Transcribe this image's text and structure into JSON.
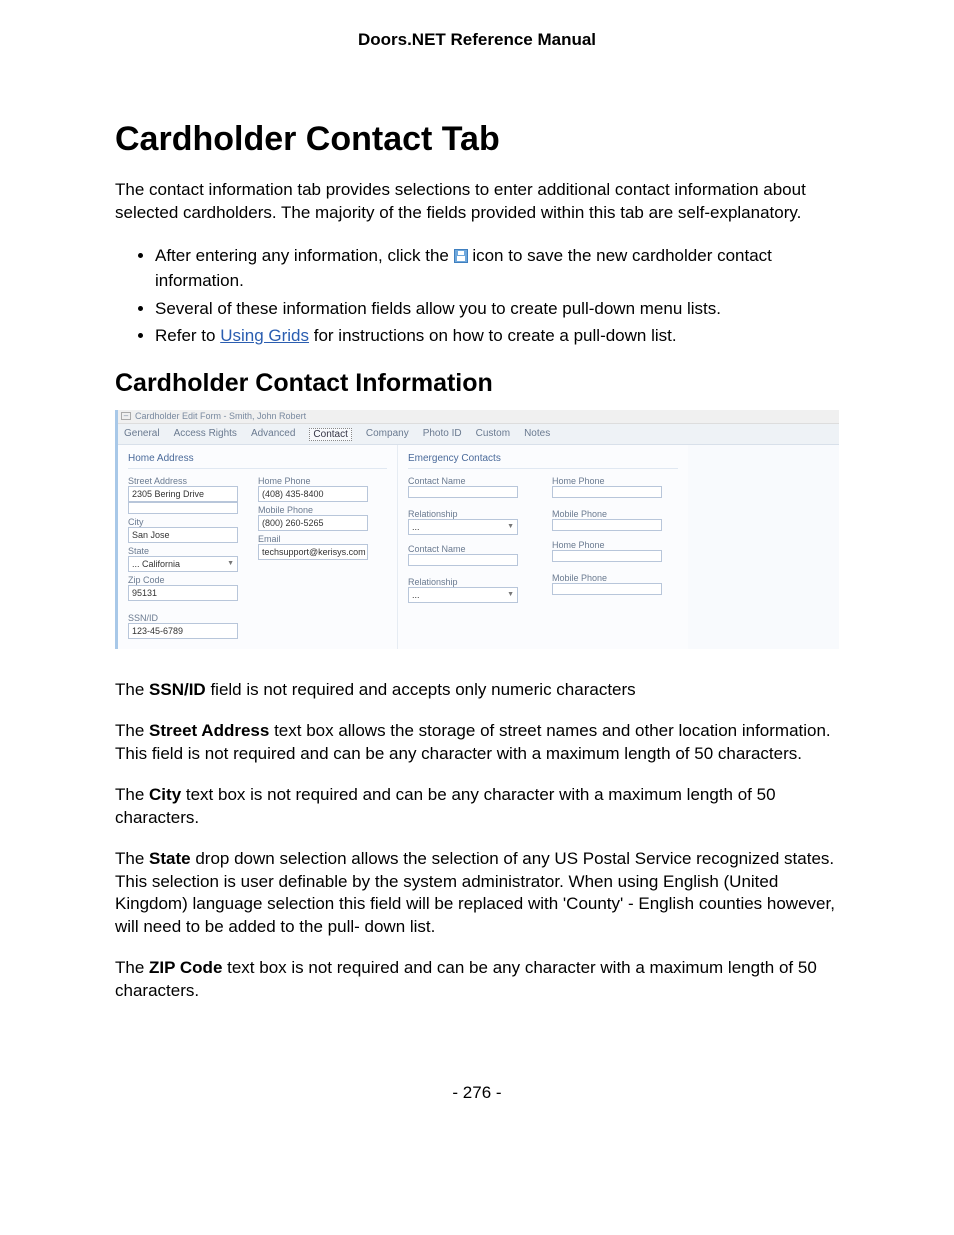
{
  "header": {
    "title": "Doors.NET Reference Manual"
  },
  "h1": "Cardholder Contact Tab",
  "intro": "The contact information tab provides selections to enter additional contact information about selected cardholders. The majority of the fields provided within this tab are self-explanatory.",
  "bullets": {
    "b1_pre": "After entering any information, click the ",
    "b1_post": " icon to save the new cardholder contact information.",
    "b2": "Several of these information fields allow you to create pull-down menu lists.",
    "b3_pre": "Refer to ",
    "b3_link": "Using Grids",
    "b3_post": " for instructions on how to create a pull-down list."
  },
  "h2": "Cardholder Contact Information",
  "shot": {
    "title": "Cardholder Edit Form - Smith, John Robert",
    "tabs": [
      "General",
      "Access Rights",
      "Advanced",
      "Contact",
      "Company",
      "Photo ID",
      "Custom",
      "Notes"
    ],
    "active_tab_index": 3,
    "home_section": "Home Address",
    "emerg_section": "Emergency Contacts",
    "labels": {
      "street": "Street Address",
      "city": "City",
      "state": "State",
      "zip": "Zip Code",
      "homeph": "Home Phone",
      "mobph": "Mobile Phone",
      "email": "Email",
      "ssn": "SSN/ID",
      "cname": "Contact Name",
      "rel": "Relationship"
    },
    "values": {
      "street": "2305 Bering Drive",
      "city": "San Jose",
      "state": "California",
      "state_prefix": "...   ",
      "zip": "95131",
      "homeph": "(408) 435-8400",
      "mobph": "(800) 260-5265",
      "email": "techsupport@kerisys.com",
      "ssn": "123-45-6789",
      "rel_placeholder": "..."
    }
  },
  "paras": {
    "ssn_pre": "The ",
    "ssn_b": "SSN/ID",
    "ssn_post": " field is not required and accepts only numeric characters",
    "street_pre": "The ",
    "street_b": "Street Address",
    "street_post": " text box allows the storage of street names and other location information. This field is not required and can be any character with a maximum length of 50 characters.",
    "city_pre": "The ",
    "city_b": "City",
    "city_post": " text box is not required and can be any character with a maximum length of 50 characters.",
    "state_pre": "The ",
    "state_b": "State",
    "state_post": " drop down selection allows the selection of any US Postal Service recognized states. This selection is user definable by the system administrator. When using English (United Kingdom) language selection this field will be replaced with 'County' - English counties however, will need to be added to the pull- down list.",
    "zip_pre": "The ",
    "zip_b": "ZIP Code",
    "zip_post": " text box is not required and can be any character with a maximum length of 50 characters."
  },
  "footer": {
    "page": "- 276 -"
  }
}
